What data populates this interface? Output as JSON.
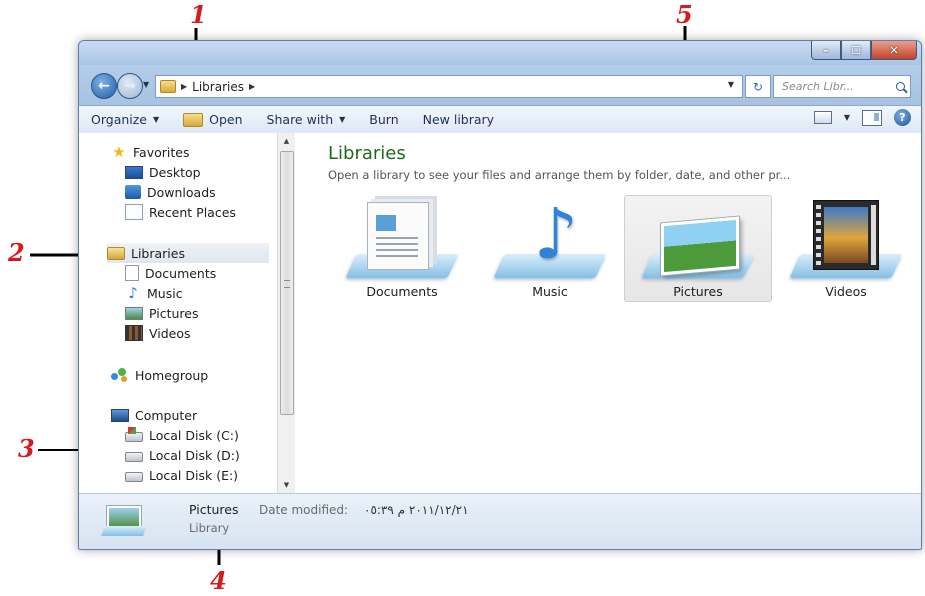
{
  "window": {
    "controls": {
      "minimize": "–",
      "maximize": "☐",
      "close": "✕"
    }
  },
  "address_bar": {
    "back": "←",
    "forward": "→",
    "path": [
      "Libraries"
    ],
    "refresh": "↻",
    "search_placeholder": "Search Libr..."
  },
  "toolbar": {
    "organize": "Organize",
    "open": "Open",
    "share_with": "Share with",
    "burn": "Burn",
    "new_library": "New library",
    "help": "?"
  },
  "nav_pane": {
    "favorites": {
      "label": "Favorites",
      "items": [
        "Desktop",
        "Downloads",
        "Recent Places"
      ]
    },
    "libraries": {
      "label": "Libraries",
      "items": [
        "Documents",
        "Music",
        "Pictures",
        "Videos"
      ]
    },
    "homegroup": "Homegroup",
    "computer": {
      "label": "Computer",
      "items": [
        "Local Disk (C:)",
        "Local Disk (D:)",
        "Local Disk (E:)"
      ]
    }
  },
  "content": {
    "title": "Libraries",
    "description": "Open a library to see your files and arrange them by folder, date, and other pr...",
    "libraries": [
      {
        "name": "Documents",
        "icon": "documents-icon"
      },
      {
        "name": "Music",
        "icon": "music-note-icon"
      },
      {
        "name": "Pictures",
        "icon": "pictures-icon",
        "selected": true
      },
      {
        "name": "Videos",
        "icon": "film-strip-icon"
      }
    ]
  },
  "details_pane": {
    "name": "Pictures",
    "meta_label": "Date modified:",
    "meta_value": "٢٠١١/١٢/٢١ م ٠٥:٣٩",
    "type": "Library"
  },
  "annotations": [
    "1",
    "2",
    "3",
    "4",
    "5"
  ],
  "colors": {
    "annotation": "#d81a1a",
    "title_green": "#1f6a1a",
    "frame": "#bfd6ee"
  }
}
